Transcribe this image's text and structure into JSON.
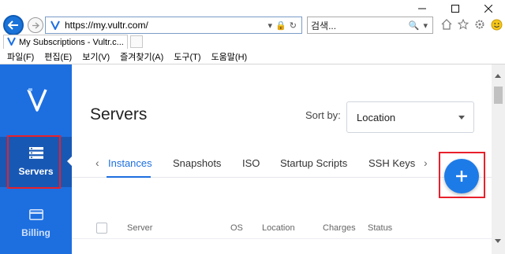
{
  "browser": {
    "url": "https://my.vultr.com/",
    "search_placeholder": "검색...",
    "tab_title": "My Subscriptions - Vultr.c...",
    "menu": [
      "파일(F)",
      "편집(E)",
      "보기(V)",
      "즐겨찾기(A)",
      "도구(T)",
      "도움말(H)"
    ],
    "window_controls": [
      "minimize-icon",
      "maximize-icon",
      "close-icon"
    ]
  },
  "sidebar": {
    "logo": "vultr-logo",
    "items": [
      {
        "label": "Servers",
        "icon": "server-list-icon",
        "active": true
      },
      {
        "label": "Billing",
        "icon": "credit-card-icon",
        "active": false
      }
    ]
  },
  "main": {
    "title": "Servers",
    "sort_label": "Sort by:",
    "sort_value": "Location",
    "tabs": [
      "Instances",
      "Snapshots",
      "ISO",
      "Startup Scripts",
      "SSH Keys"
    ],
    "active_tab": "Instances",
    "add_button_icon": "plus-icon",
    "table_columns": [
      "Server",
      "OS",
      "Location",
      "Charges",
      "Status"
    ]
  },
  "colors": {
    "brand_blue": "#1d6fe0",
    "sidebar_active": "#1858b5",
    "highlight_red": "#e8202a",
    "add_button": "#1d7be8"
  }
}
